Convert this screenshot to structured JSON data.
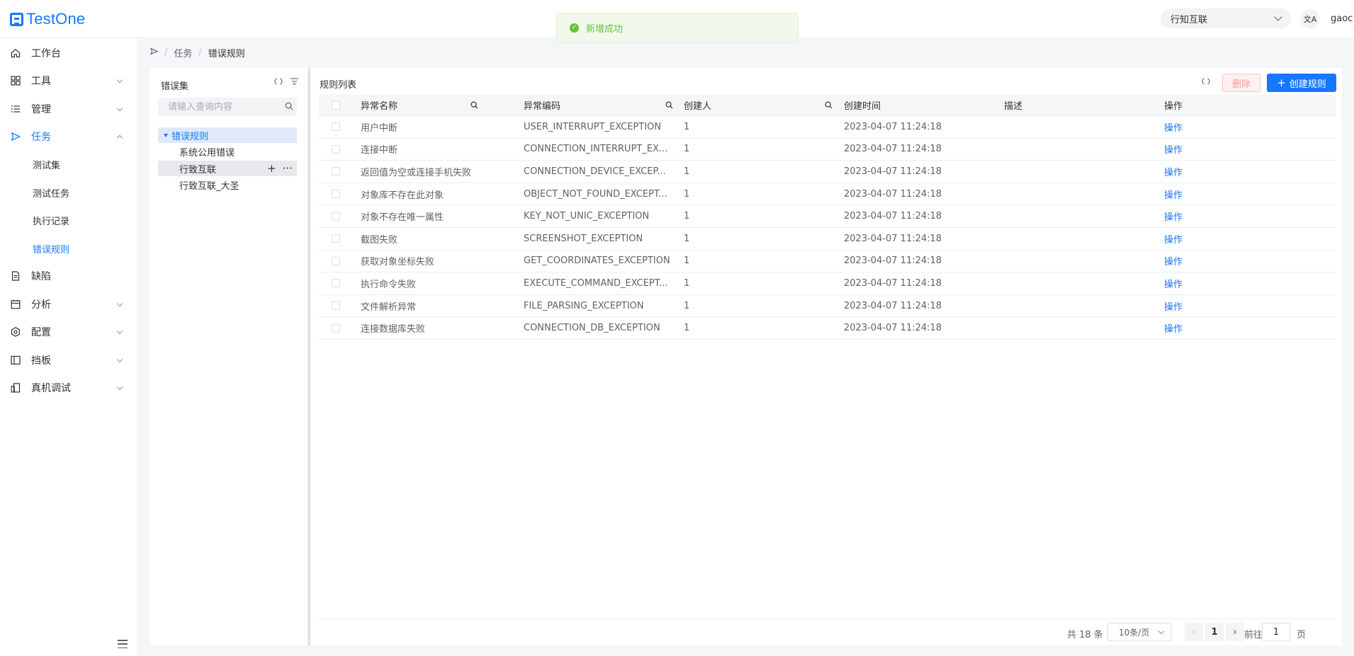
{
  "app": {
    "logo": "TestOne"
  },
  "topbar": {
    "org": "行知互联",
    "lang_icon": "文A",
    "user": "gaoc"
  },
  "toast": {
    "text": "新增成功"
  },
  "sidebar": {
    "items": [
      {
        "label": "工作台",
        "icon": "home-icon"
      },
      {
        "label": "工具",
        "icon": "grid-icon"
      },
      {
        "label": "管理",
        "icon": "list-icon"
      },
      {
        "label": "任务",
        "icon": "send-icon"
      },
      {
        "label": "缺陷",
        "icon": "document-icon"
      },
      {
        "label": "分析",
        "icon": "calendar-icon"
      },
      {
        "label": "配置",
        "icon": "gear-icon"
      },
      {
        "label": "挡板",
        "icon": "panel-icon"
      },
      {
        "label": "真机调试",
        "icon": "device-icon"
      }
    ],
    "sub_items": [
      "测试集",
      "测试任务",
      "执行记录",
      "错误规则"
    ]
  },
  "breadcrumb": {
    "items": [
      "任务",
      "错误规则"
    ]
  },
  "tree": {
    "title": "错误集",
    "search_placeholder": "请输入查询内容",
    "root": "错误规则",
    "children": [
      "系统公用错误",
      "行致互联",
      "行致互联_大圣"
    ]
  },
  "table": {
    "title": "规则列表",
    "delete_label": "删除",
    "create_label": "创建规则",
    "headers": [
      "异常名称",
      "异常编码",
      "创建人",
      "创建时间",
      "描述",
      "操作"
    ],
    "rows": [
      {
        "name": "用户中断",
        "code": "USER_INTERRUPT_EXCEPTION",
        "creator": "1",
        "time": "2023-04-07 11:24:18",
        "desc": "",
        "op": "操作"
      },
      {
        "name": "连接中断",
        "code": "CONNECTION_INTERRUPT_EX...",
        "creator": "1",
        "time": "2023-04-07 11:24:18",
        "desc": "",
        "op": "操作"
      },
      {
        "name": "返回值为空或连接手机失败",
        "code": "CONNECTION_DEVICE_EXCEP...",
        "creator": "1",
        "time": "2023-04-07 11:24:18",
        "desc": "",
        "op": "操作"
      },
      {
        "name": "对象库不存在此对象",
        "code": "OBJECT_NOT_FOUND_EXCEPT...",
        "creator": "1",
        "time": "2023-04-07 11:24:18",
        "desc": "",
        "op": "操作"
      },
      {
        "name": "对象不存在唯一属性",
        "code": "KEY_NOT_UNIC_EXCEPTION",
        "creator": "1",
        "time": "2023-04-07 11:24:18",
        "desc": "",
        "op": "操作"
      },
      {
        "name": "截图失败",
        "code": "SCREENSHOT_EXCEPTION",
        "creator": "1",
        "time": "2023-04-07 11:24:18",
        "desc": "",
        "op": "操作"
      },
      {
        "name": "获取对象坐标失败",
        "code": "GET_COORDINATES_EXCEPTION",
        "creator": "1",
        "time": "2023-04-07 11:24:18",
        "desc": "",
        "op": "操作"
      },
      {
        "name": "执行命令失败",
        "code": "EXECUTE_COMMAND_EXCEPT...",
        "creator": "1",
        "time": "2023-04-07 11:24:18",
        "desc": "",
        "op": "操作"
      },
      {
        "name": "文件解析异常",
        "code": "FILE_PARSING_EXCEPTION",
        "creator": "1",
        "time": "2023-04-07 11:24:18",
        "desc": "",
        "op": "操作"
      },
      {
        "name": "连接数据库失败",
        "code": "CONNECTION_DB_EXCEPTION",
        "creator": "1",
        "time": "2023-04-07 11:24:18",
        "desc": "",
        "op": "操作"
      }
    ]
  },
  "pagination": {
    "total": "共 18 条",
    "page_size": "10条/页",
    "current": "1",
    "goto_label": "前往",
    "goto_value": "1",
    "page_label": "页"
  },
  "colors": {
    "brand": "#1677ff",
    "success": "#67c23a",
    "danger": "#f56c6c"
  }
}
